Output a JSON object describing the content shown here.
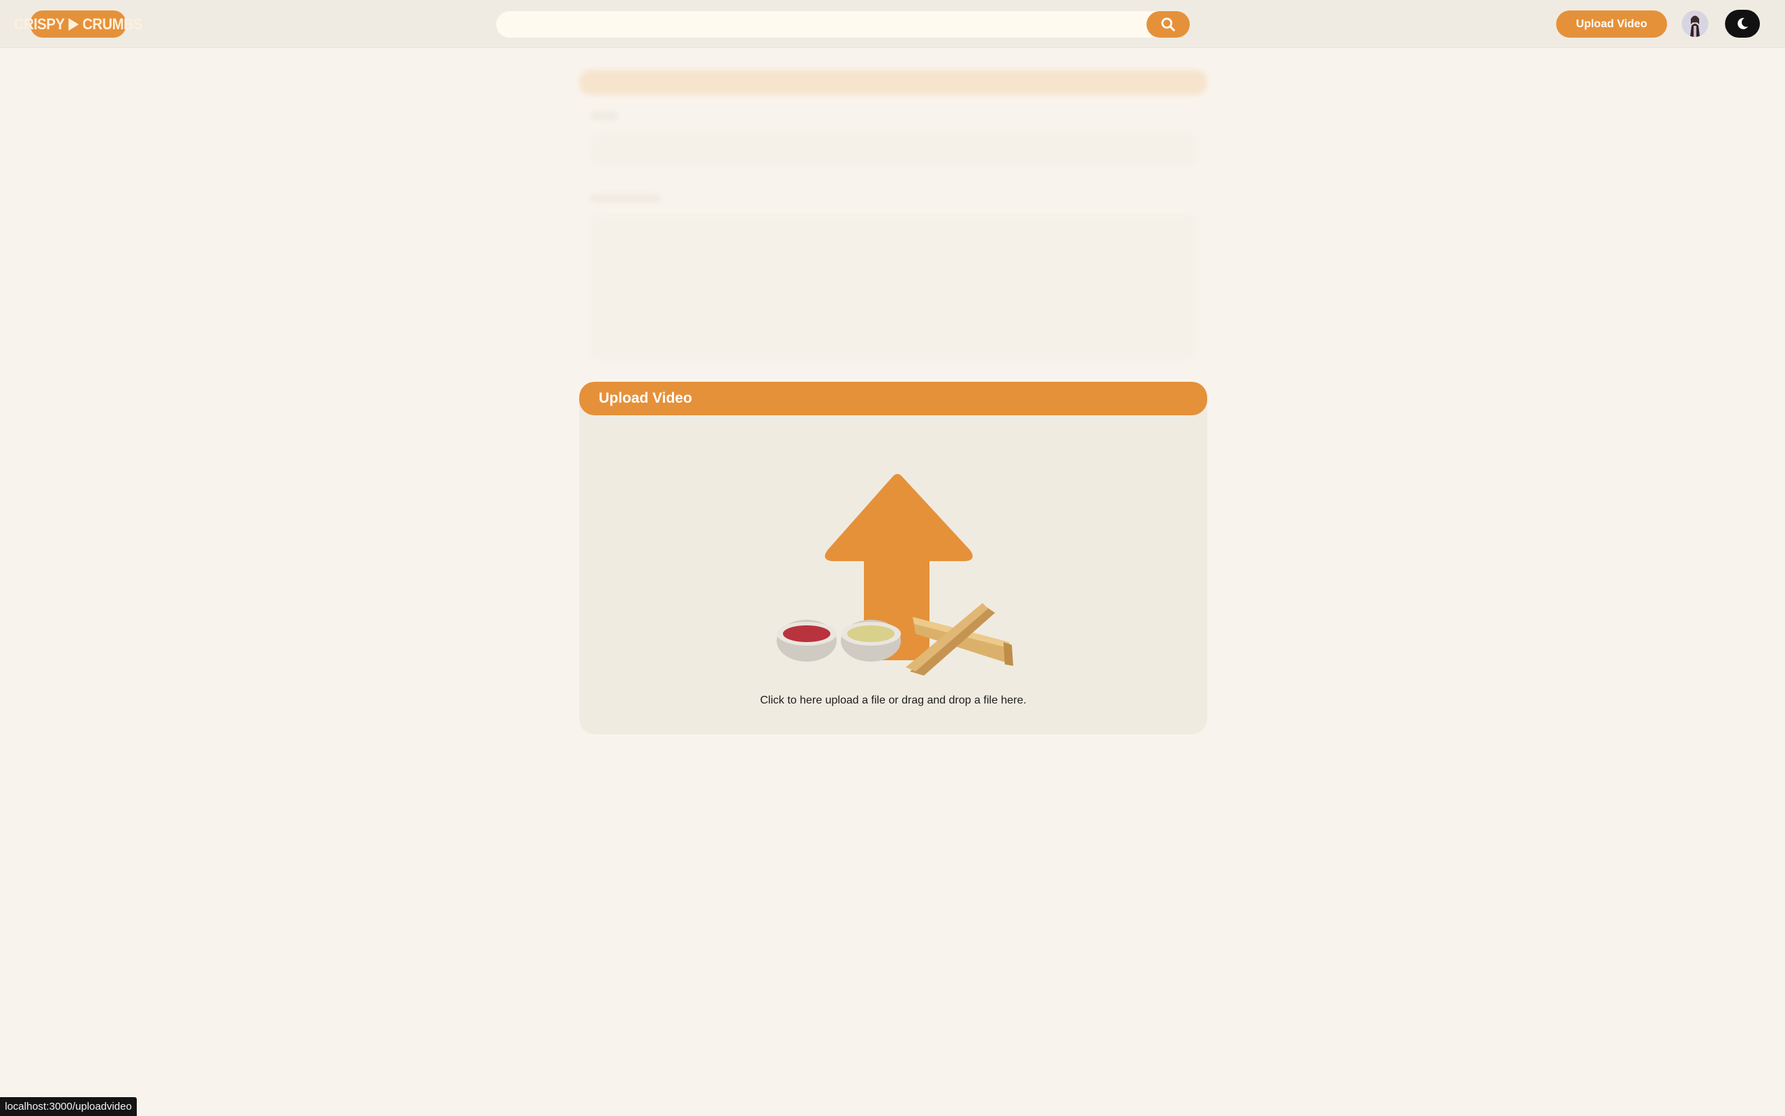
{
  "header": {
    "logo": {
      "left": "CRISPY",
      "right": "CRUMBS"
    },
    "search": {
      "placeholder": ""
    },
    "upload_button": "Upload Video",
    "icons": {
      "search": "search-icon",
      "theme": "moon-icon"
    }
  },
  "upload_card": {
    "title": "Upload Video",
    "hint": "Click to here upload a file or drag and drop a file here."
  },
  "status_bar": {
    "url": "localhost:3000/uploadvideo"
  },
  "colors": {
    "accent": "#e5913a",
    "background": "#f8f4ed",
    "card": "#f0ebe1"
  }
}
